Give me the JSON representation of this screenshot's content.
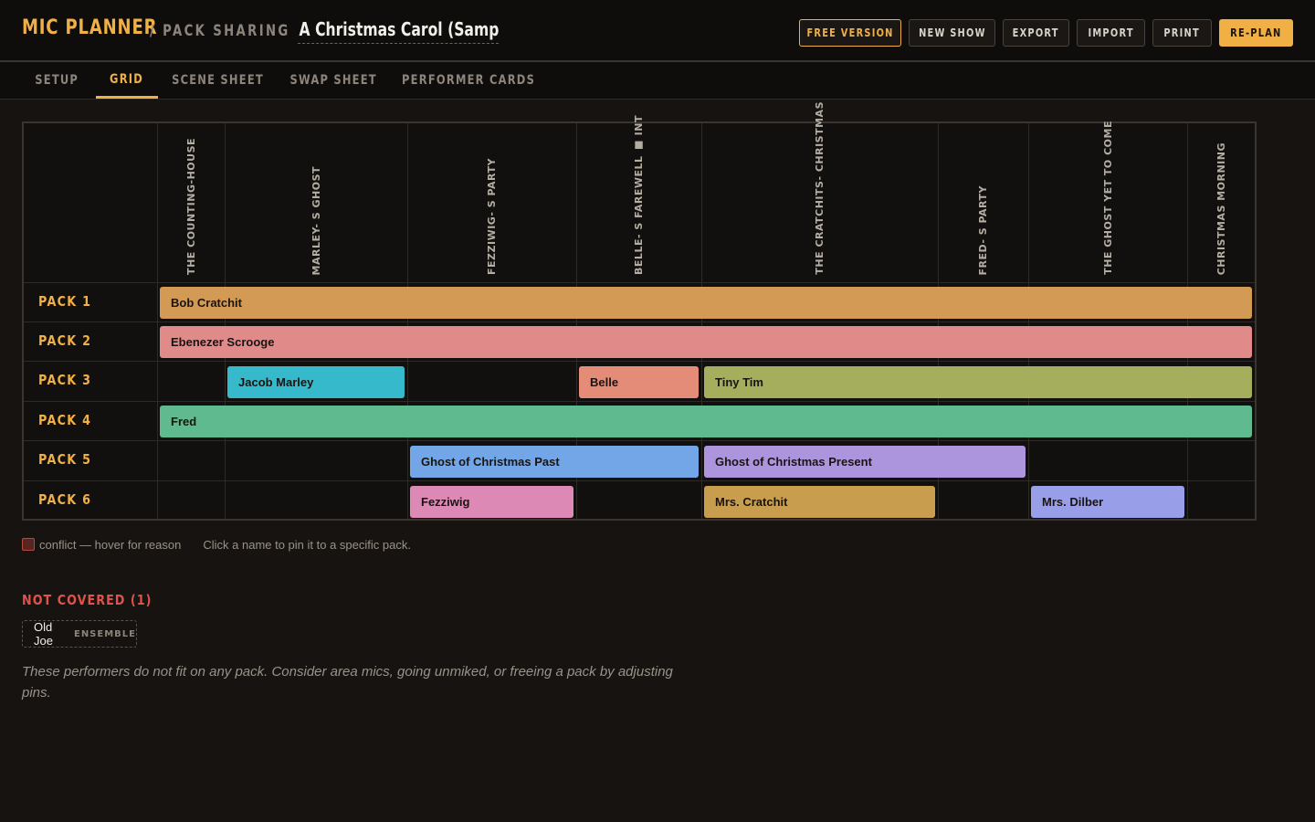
{
  "header": {
    "brand": "MIC PLANNER",
    "brand_sub": "/ PACK SHARING",
    "show_title": "A Christmas Carol (Sample)",
    "buttons": {
      "free_version": "FREE VERSION",
      "new_show": "NEW SHOW",
      "export": "EXPORT",
      "import": "IMPORT",
      "print": "PRINT",
      "replan": "RE-PLAN"
    }
  },
  "tabs": [
    "SETUP",
    "GRID",
    "SCENE SHEET",
    "SWAP SHEET",
    "PERFORMER CARDS"
  ],
  "active_tab": "GRID",
  "scenes": [
    "THE COUNTING-HOUSE",
    "MARLEY- S GHOST",
    "FEZZIWIG- S PARTY",
    "BELLE- S FAREWELL ■ INT",
    "THE CRATCHITS- CHRISTMAS",
    "FRED- S PARTY",
    "THE GHOST YET TO COME",
    "CHRISTMAS MORNING"
  ],
  "packs": [
    "PACK 1",
    "PACK 2",
    "PACK 3",
    "PACK 4",
    "PACK 5",
    "PACK 6"
  ],
  "assignments": [
    {
      "pack": 0,
      "name": "Bob Cratchit",
      "start": 0,
      "end": 7,
      "color": "#d29a55"
    },
    {
      "pack": 1,
      "name": "Ebenezer Scrooge",
      "start": 0,
      "end": 7,
      "color": "#e08a8a"
    },
    {
      "pack": 2,
      "name": "Jacob Marley",
      "start": 1,
      "end": 1,
      "color": "#37b9cc"
    },
    {
      "pack": 2,
      "name": "Belle",
      "start": 3,
      "end": 3,
      "color": "#e58c78"
    },
    {
      "pack": 2,
      "name": "Tiny Tim",
      "start": 4,
      "end": 7,
      "color": "#a4ae5d"
    },
    {
      "pack": 3,
      "name": "Fred",
      "start": 0,
      "end": 7,
      "color": "#5fba8f"
    },
    {
      "pack": 4,
      "name": "Ghost of Christmas Past",
      "start": 2,
      "end": 3,
      "color": "#73a6e6"
    },
    {
      "pack": 4,
      "name": "Ghost of Christmas Present",
      "start": 4,
      "end": 5,
      "color": "#ad95dd"
    },
    {
      "pack": 5,
      "name": "Fezziwig",
      "start": 2,
      "end": 2,
      "color": "#dc8ab5"
    },
    {
      "pack": 5,
      "name": "Mrs. Cratchit",
      "start": 4,
      "end": 4,
      "color": "#c89e4e"
    },
    {
      "pack": 5,
      "name": "Mrs. Dilber",
      "start": 6,
      "end": 6,
      "color": "#999ee8"
    }
  ],
  "legend": {
    "conflict": "conflict — hover for reason",
    "hint": "Click a name to pin it to a specific pack."
  },
  "not_covered": {
    "title": "NOT COVERED (1)",
    "performers": [
      {
        "name": "Old Joe",
        "tag": "ENSEMBLE"
      }
    ],
    "note": "These performers do not fit on any pack. Consider area mics, going unmiked, or freeing a pack by adjusting pins."
  },
  "colors": {
    "accent": "#f0b046",
    "danger": "#e0524a",
    "background": "#161311"
  }
}
